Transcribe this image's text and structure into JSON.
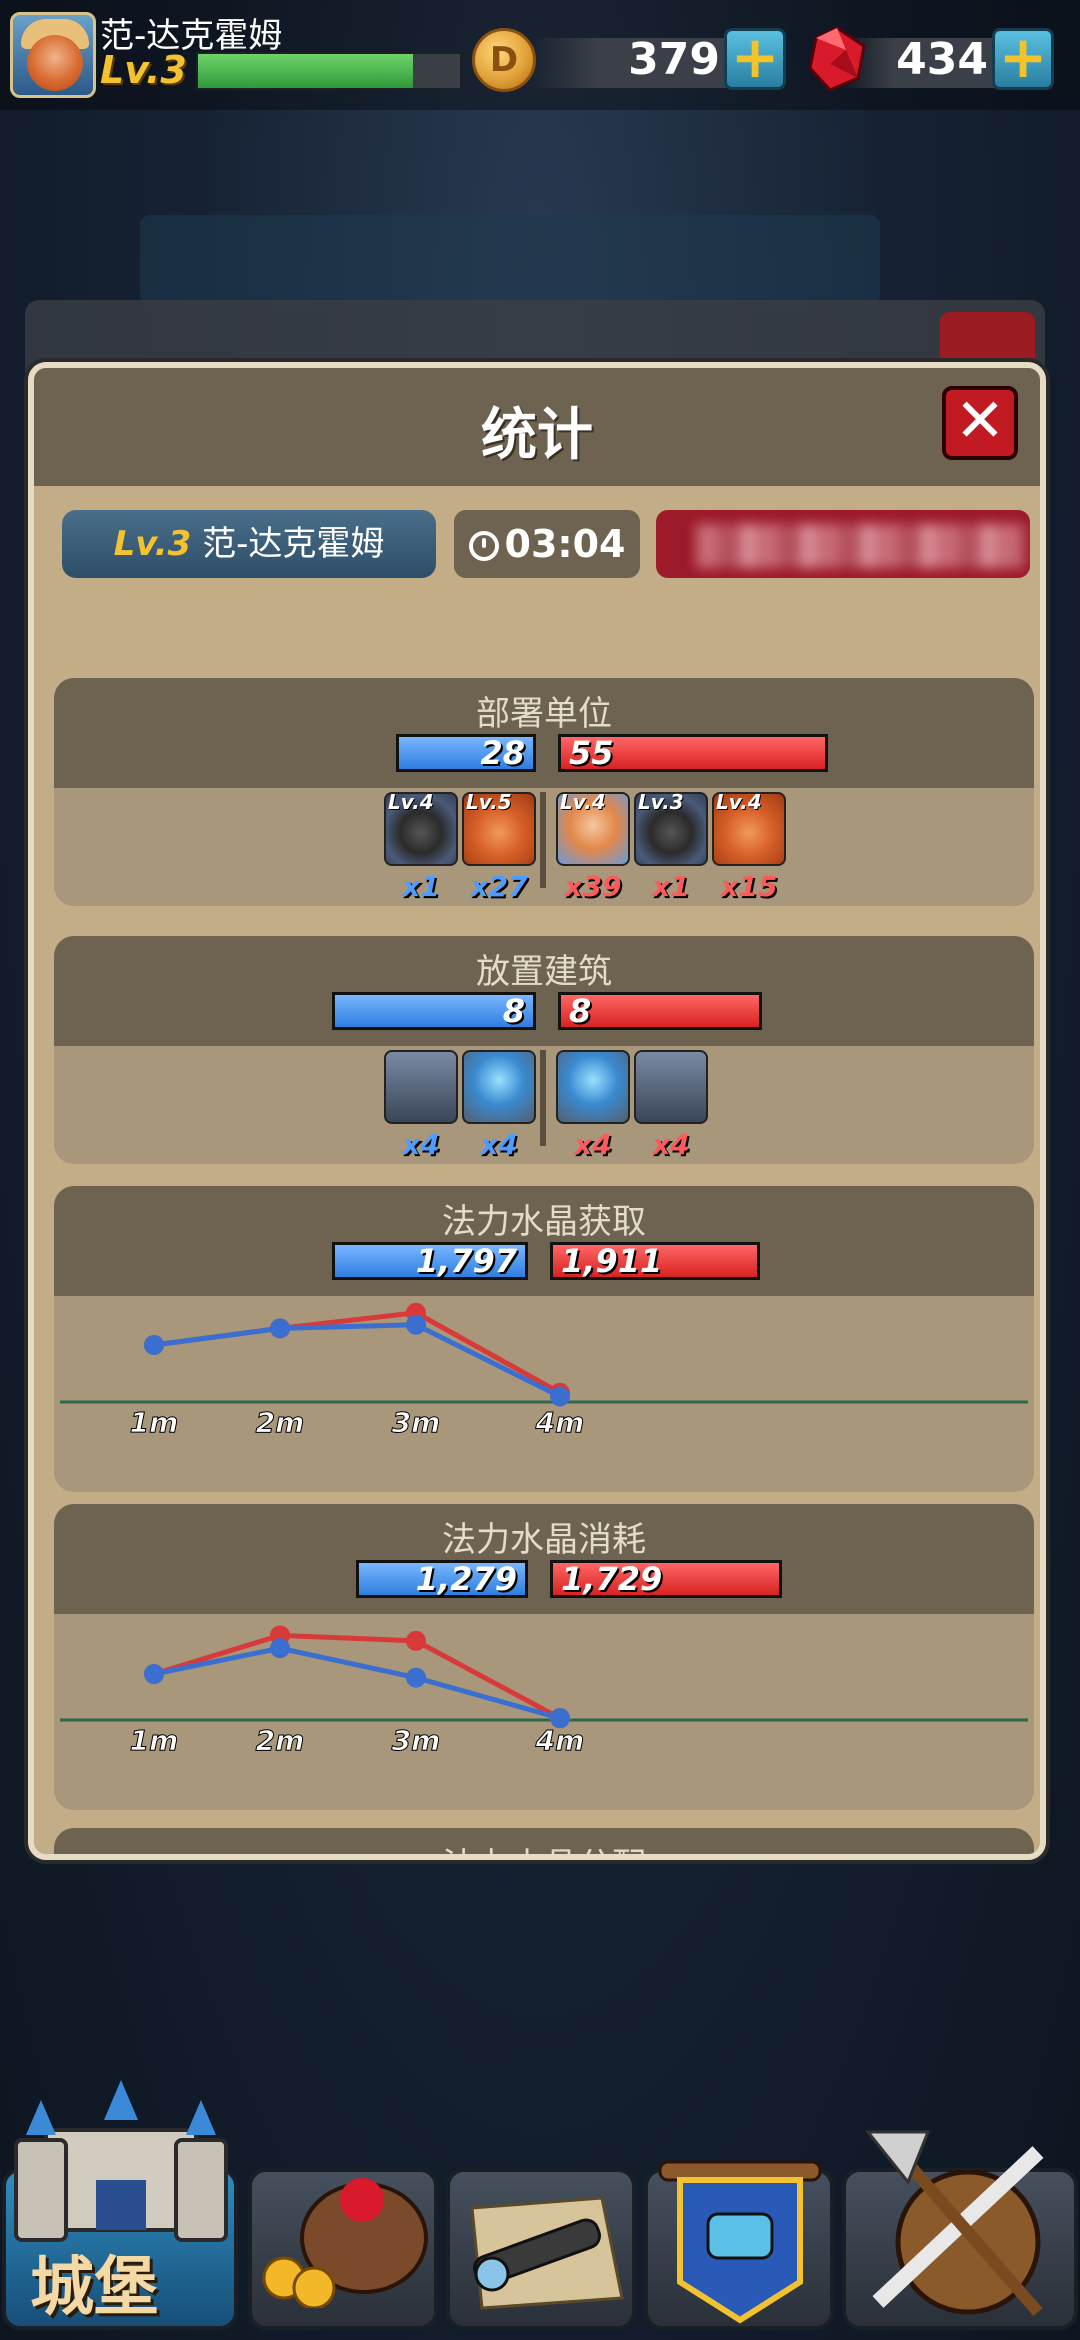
{
  "hud": {
    "player_name": "范-达克霍姆",
    "level": "Lv.3",
    "xp_fraction": 0.82,
    "gold": "379",
    "gems": "434"
  },
  "dialog": {
    "title": "统计",
    "player_label_lv": "Lv.3",
    "player_label_name": "范-达克霍姆",
    "match_time": "03:04",
    "opponent_name": ""
  },
  "sections": {
    "units": {
      "title": "部署单位",
      "blue_total": "28",
      "red_total": "55",
      "blue_units": [
        {
          "level": "Lv.4",
          "count": "x1",
          "icon": "bomb-skull-icon"
        },
        {
          "level": "Lv.5",
          "count": "x27",
          "icon": "dwarf-warrior-icon"
        }
      ],
      "red_units": [
        {
          "level": "Lv.4",
          "count": "x39",
          "icon": "archer-girl-icon"
        },
        {
          "level": "Lv.3",
          "count": "x1",
          "icon": "bomb-skull-icon"
        },
        {
          "level": "Lv.4",
          "count": "x15",
          "icon": "dwarf-warrior-icon"
        }
      ]
    },
    "buildings": {
      "title": "放置建筑",
      "blue_total": "8",
      "red_total": "8",
      "blue_units": [
        {
          "count": "x4",
          "icon": "watch-tower-icon"
        },
        {
          "count": "x4",
          "icon": "mana-crystal-tower-icon"
        }
      ],
      "red_units": [
        {
          "count": "x4",
          "icon": "mana-crystal-tower-icon"
        },
        {
          "count": "x4",
          "icon": "watch-tower-icon"
        }
      ]
    },
    "mana_gain": {
      "title": "法力水晶获取",
      "blue_total": "1,797",
      "red_total": "1,911"
    },
    "mana_spend": {
      "title": "法力水晶消耗",
      "blue_total": "1,279",
      "red_total": "1,729"
    },
    "partial_title": "法力水晶分配"
  },
  "chart_data": [
    {
      "type": "line",
      "title": "法力水晶获取",
      "x": [
        "1m",
        "2m",
        "3m",
        "4m"
      ],
      "series": [
        {
          "color": "#3a6fd0",
          "values": [
            0.62,
            0.8,
            0.84,
            0.06
          ]
        },
        {
          "color": "#d83a3a",
          "values": [
            0.62,
            0.8,
            0.97,
            0.1
          ]
        }
      ],
      "ylim": [
        0,
        1
      ]
    },
    {
      "type": "line",
      "title": "法力水晶消耗",
      "x": [
        "1m",
        "2m",
        "3m",
        "4m"
      ],
      "series": [
        {
          "color": "#3a6fd0",
          "values": [
            0.5,
            0.78,
            0.46,
            0.02
          ]
        },
        {
          "color": "#d83a3a",
          "values": [
            0.5,
            0.92,
            0.86,
            0.02
          ]
        }
      ],
      "ylim": [
        0,
        1
      ]
    }
  ],
  "nav": {
    "castle_label": "城堡",
    "items": [
      "shop-icon",
      "explore-icon",
      "chat-banner-icon",
      "battle-icon"
    ]
  },
  "colors": {
    "blue_team": "#2e7ee0",
    "red_team": "#d82222",
    "panel": "#c2ad86",
    "panel_header": "#6e6250"
  }
}
